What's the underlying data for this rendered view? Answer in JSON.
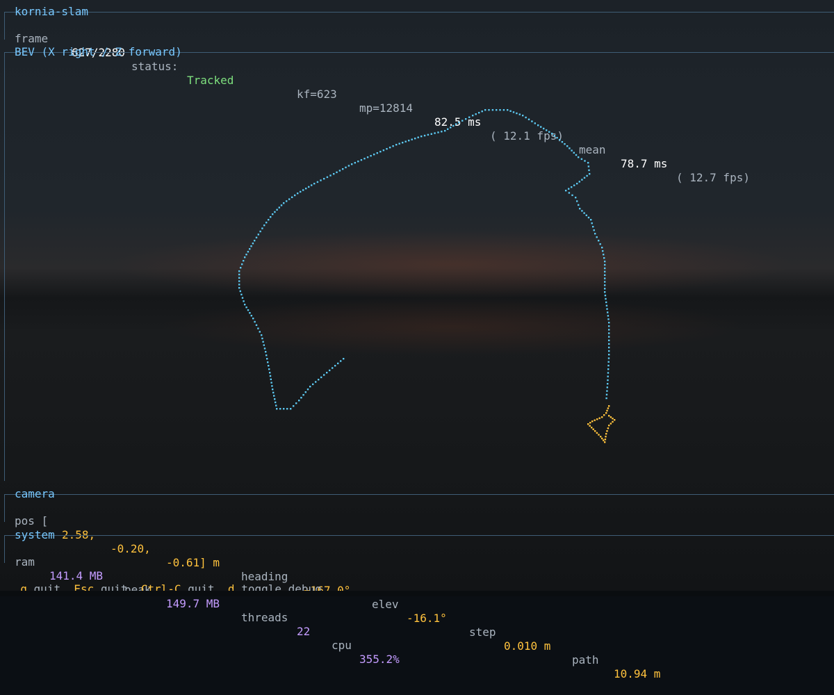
{
  "header": {
    "title": "kornia-slam",
    "frame_label": "frame",
    "frame_value": "627/2280",
    "status_label": "status:",
    "status_value": "Tracked",
    "kf": "kf=623",
    "mp": "mp=12814",
    "ms_value": "82.5 ms",
    "fps_value": "( 12.1 fps)",
    "mean_label": "mean",
    "mean_ms": "78.7 ms",
    "mean_fps": "( 12.7 fps)"
  },
  "bev": {
    "title": "BEV (X right / Z forward)",
    "path_color": "#5cc8f0",
    "camera_color": "#ffc23d"
  },
  "camera": {
    "title": "camera",
    "pos_label": "pos [",
    "pos_x": "2.58,",
    "pos_y": "-0.20,",
    "pos_z": "-0.61] m",
    "heading_label": "heading",
    "heading_value": "+167.0°",
    "elev_label": "elev",
    "elev_value": "-16.1°",
    "step_label": "step",
    "step_value": "0.010 m",
    "path_label": "path",
    "path_value": "10.94 m"
  },
  "system": {
    "title": "system",
    "ram_label": "ram",
    "ram_value": "141.4 MB",
    "peak_label": "peak",
    "peak_value": "149.7 MB",
    "threads_label": "threads",
    "threads_value": "22",
    "cpu_label": "cpu",
    "cpu_value": "355.2%"
  },
  "keys": [
    {
      "key": "q",
      "action": "quit"
    },
    {
      "key": "Esc",
      "action": "quit"
    },
    {
      "key": "Ctrl-C",
      "action": "quit"
    },
    {
      "key": "d",
      "action": "toggle debug"
    }
  ]
}
